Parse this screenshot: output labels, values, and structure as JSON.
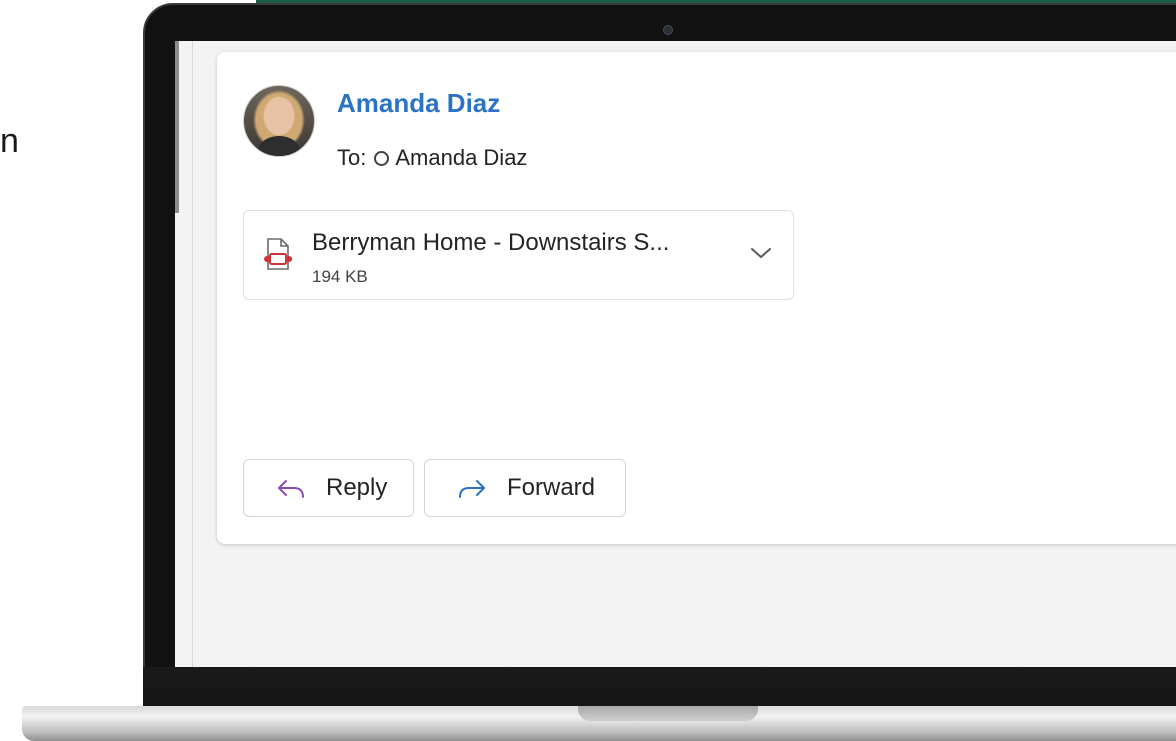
{
  "side_text": "n",
  "email": {
    "sender": {
      "name": "Amanda Diaz",
      "to_label": "To:",
      "to_recipient": "Amanda Diaz"
    },
    "attachment": {
      "name": "Berryman Home - Downstairs S...",
      "size": "194 KB",
      "icon": "pdf-file-icon"
    },
    "actions": {
      "reply_label": "Reply",
      "forward_label": "Forward"
    }
  },
  "colors": {
    "accent": "#2b73c4",
    "reply_icon": "#8e4bb2",
    "forward_icon": "#2b73c4",
    "file_icon": "#d13438",
    "green_band": "#1d5e49"
  }
}
